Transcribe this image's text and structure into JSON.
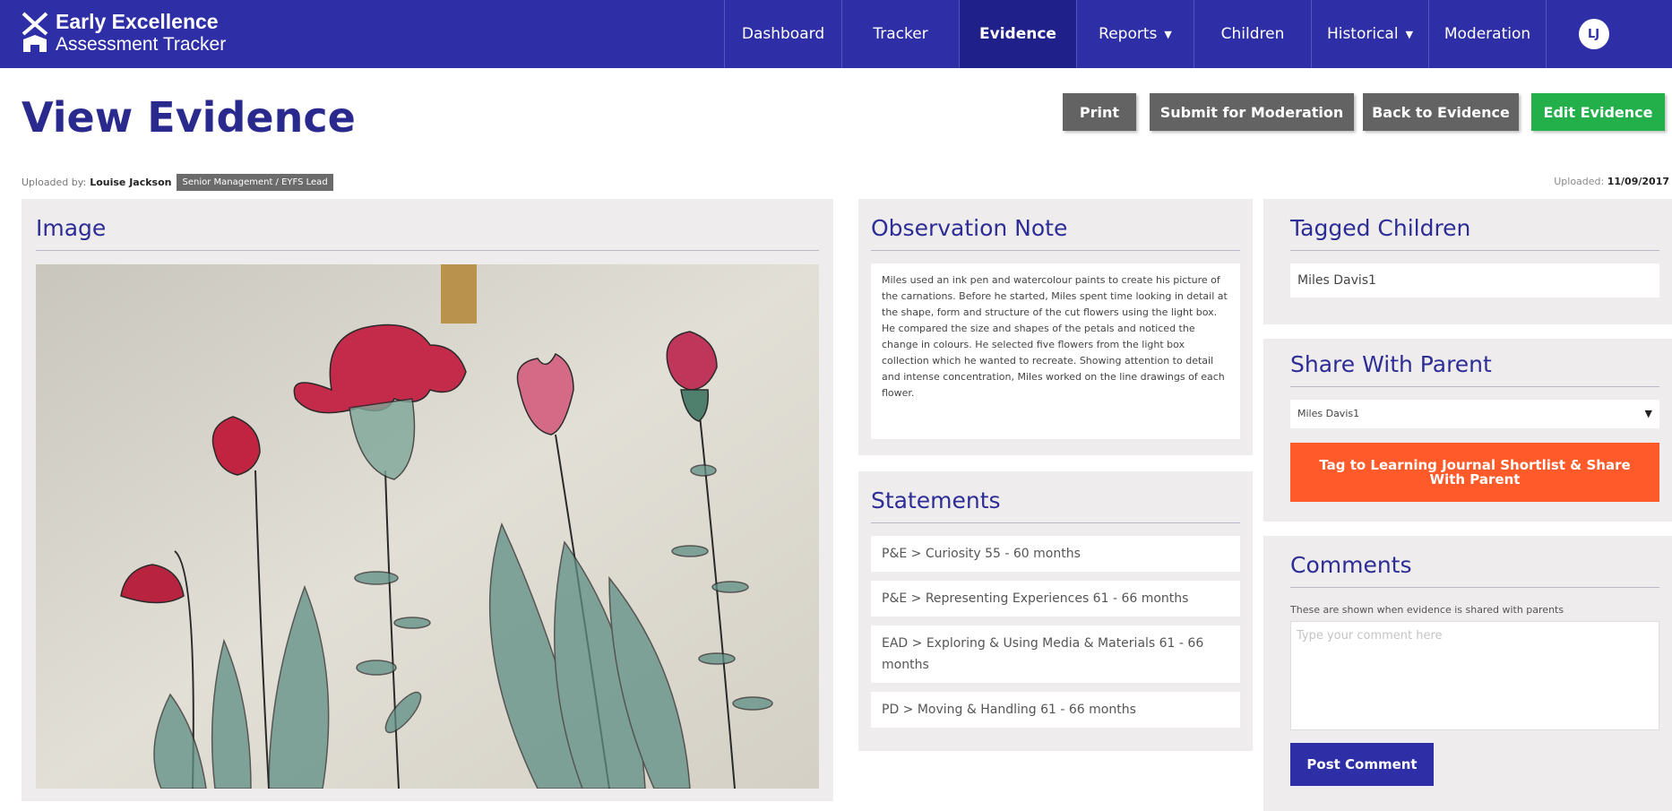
{
  "brand": {
    "line1": "Early Excellence",
    "line2": "Assessment Tracker"
  },
  "nav": {
    "items": [
      {
        "label": "Dashboard",
        "active": false,
        "dropdown": false
      },
      {
        "label": "Tracker",
        "active": false,
        "dropdown": false
      },
      {
        "label": "Evidence",
        "active": true,
        "dropdown": false
      },
      {
        "label": "Reports",
        "active": false,
        "dropdown": true
      },
      {
        "label": "Children",
        "active": false,
        "dropdown": false
      },
      {
        "label": "Historical",
        "active": false,
        "dropdown": true
      },
      {
        "label": "Moderation",
        "active": false,
        "dropdown": false
      }
    ],
    "avatar_initials": "LJ"
  },
  "page": {
    "title": "View Evidence"
  },
  "actions": {
    "print": "Print",
    "submit": "Submit for Moderation",
    "back": "Back to Evidence",
    "edit": "Edit Evidence"
  },
  "meta": {
    "uploaded_by_label": "Uploaded by:",
    "uploaded_by_name": "Louise Jackson",
    "role": "Senior Management / EYFS Lead",
    "uploaded_label": "Uploaded:",
    "uploaded_date": "11/09/2017"
  },
  "image_panel": {
    "title": "Image"
  },
  "observation": {
    "title": "Observation Note",
    "text": "Miles used an ink pen and watercolour paints to create his picture of the carnations. Before he started, Miles spent time looking in detail at the shape, form and structure of the cut flowers using the light box. He compared the size and shapes of the petals and noticed the change in colours. He selected five flowers from the light box collection which he wanted to recreate. Showing attention to detail and intense concentration, Miles worked on the line drawings of each flower."
  },
  "statements": {
    "title": "Statements",
    "items": [
      "P&E > Curiosity 55 - 60 months",
      "P&E > Representing Experiences 61 - 66 months",
      "EAD > Exploring & Using Media & Materials 61 - 66 months",
      "PD > Moving & Handling 61 - 66 months"
    ]
  },
  "tagged": {
    "title": "Tagged Children",
    "child": "Miles Davis1"
  },
  "share": {
    "title": "Share With Parent",
    "selected": "Miles Davis1",
    "button": "Tag to Learning Journal Shortlist & Share With Parent"
  },
  "comments": {
    "title": "Comments",
    "note": "These are shown when evidence is shared with parents",
    "placeholder": "Type your comment here",
    "post_button": "Post Comment"
  },
  "colors": {
    "header": "#2e2ea7",
    "title": "#2a2a8e",
    "edit_button": "#23b04a",
    "share_button": "#ff5a2a",
    "grey_button": "#636363"
  }
}
